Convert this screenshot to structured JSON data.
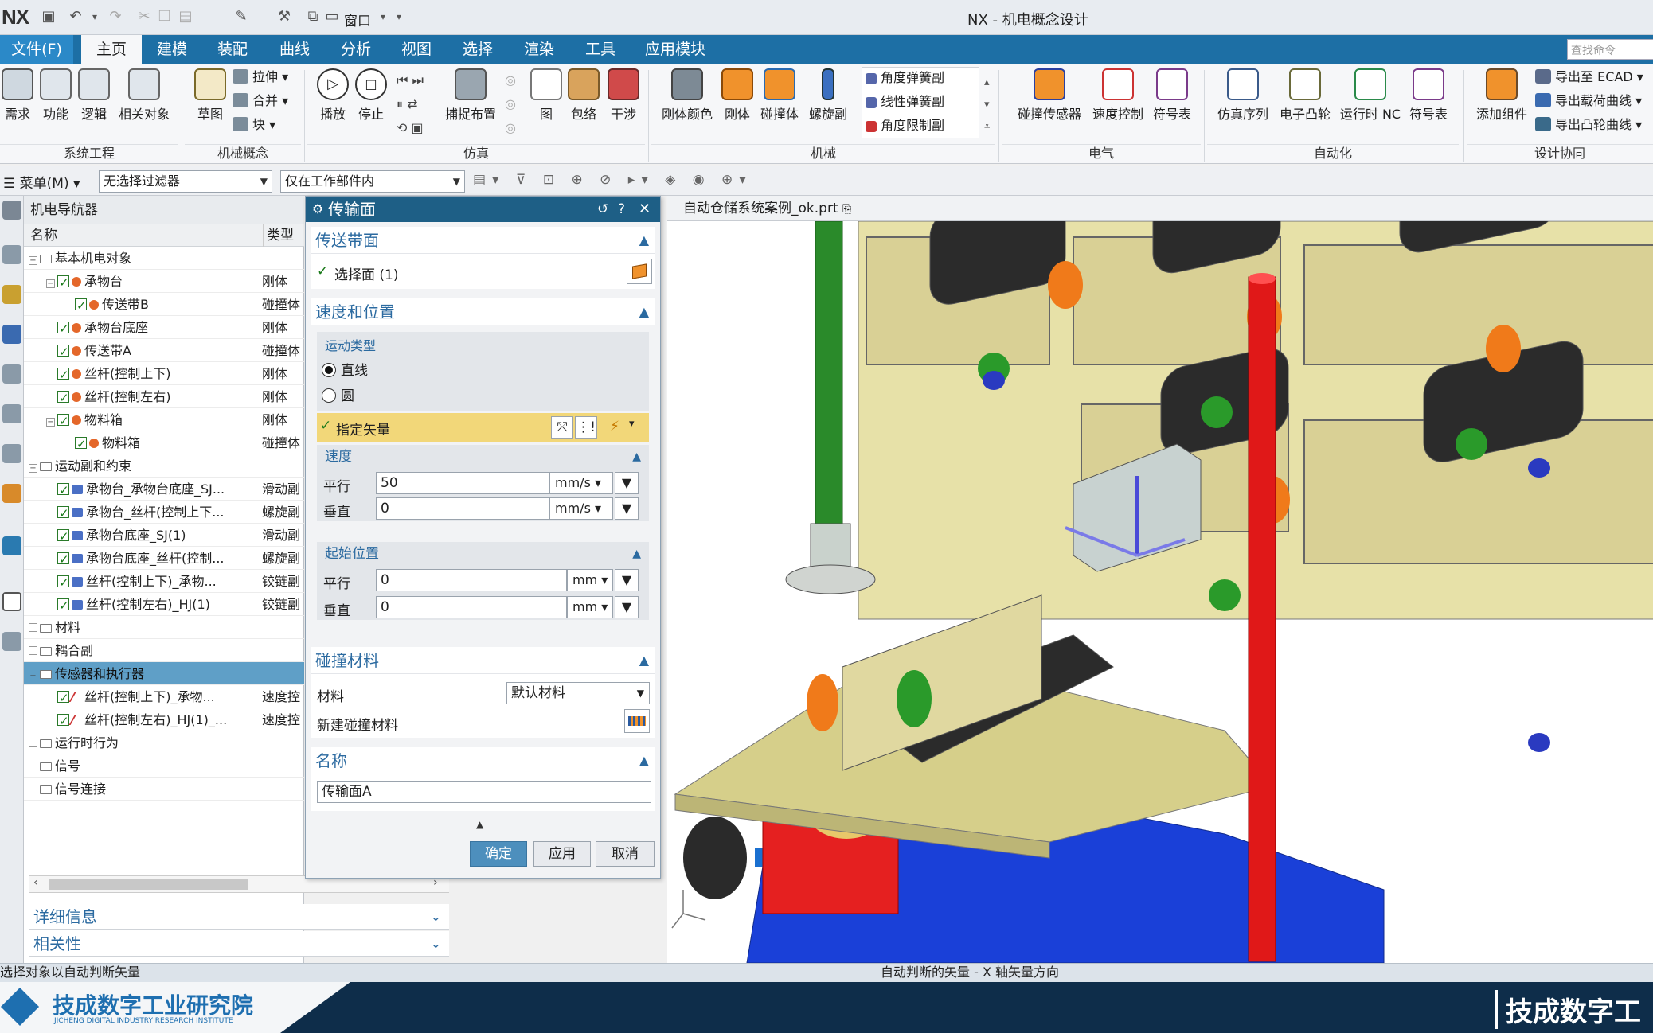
{
  "app": {
    "logo": "NX",
    "window_title": "NX - 机电概念设计",
    "window_menu": "窗口"
  },
  "tabs": [
    "文件(F)",
    "主页",
    "建模",
    "装配",
    "曲线",
    "分析",
    "视图",
    "选择",
    "渲染",
    "工具",
    "应用模块"
  ],
  "active_tab": "主页",
  "search_placeholder": "查找命令",
  "ribbon": {
    "groups": [
      "系统工程",
      "机械概念",
      "仿真",
      "机械",
      "电气",
      "自动化",
      "设计协同"
    ],
    "buttons": {
      "requirement": "需求",
      "function": "功能",
      "logic": "逻辑",
      "related_object": "相关对象",
      "sketch": "草图",
      "extrude": "拉伸",
      "unite": "合并",
      "block": "块",
      "play": "播放",
      "stop": "停止",
      "snap_layout": "捕捉布置",
      "graph": "图",
      "wrap": "包络",
      "interference": "干涉",
      "rigid_color": "刚体颜色",
      "rigid_body": "刚体",
      "collision_body": "碰撞体",
      "screw_joint": "螺旋副",
      "angular_spring": "角度弹簧副",
      "linear_spring": "线性弹簧副",
      "angular_limit": "角度限制副",
      "collision_sensor": "碰撞传感器",
      "speed_control": "速度控制",
      "symbol_table": "符号表",
      "sim_sequence": "仿真序列",
      "e_cam": "电子凸轮",
      "runtime_nc": "运行时 NC",
      "symbol_table2": "符号表",
      "add_component": "添加组件",
      "export_ecad": "导出至 ECAD",
      "export_load_curve": "导出载荷曲线",
      "export_cam_curve": "导出凸轮曲线"
    }
  },
  "selection_bar": {
    "menu": "菜单(M)",
    "filter": "无选择过滤器",
    "scope": "仅在工作部件内"
  },
  "navigator": {
    "title": "机电导航器",
    "col_name": "名称",
    "col_type": "类型",
    "rows": [
      {
        "label": "基本机电对象",
        "type": "",
        "level": 0,
        "kind": "folder"
      },
      {
        "label": "承物台",
        "type": "刚体",
        "level": 1,
        "kind": "body"
      },
      {
        "label": "传送带B",
        "type": "碰撞体",
        "level": 2,
        "kind": "body"
      },
      {
        "label": "承物台底座",
        "type": "刚体",
        "level": 1,
        "kind": "body"
      },
      {
        "label": "传送带A",
        "type": "碰撞体",
        "level": 1,
        "kind": "body"
      },
      {
        "label": "丝杆(控制上下)",
        "type": "刚体",
        "level": 1,
        "kind": "body"
      },
      {
        "label": "丝杆(控制左右)",
        "type": "刚体",
        "level": 1,
        "kind": "body"
      },
      {
        "label": "物料箱",
        "type": "刚体",
        "level": 1,
        "kind": "body"
      },
      {
        "label": "物料箱",
        "type": "碰撞体",
        "level": 2,
        "kind": "body"
      },
      {
        "label": "运动副和约束",
        "type": "",
        "level": 0,
        "kind": "folder"
      },
      {
        "label": "承物台_承物台底座_SJ...",
        "type": "滑动副",
        "level": 1,
        "kind": "joint"
      },
      {
        "label": "承物台_丝杆(控制上下...",
        "type": "螺旋副",
        "level": 1,
        "kind": "joint"
      },
      {
        "label": "承物台底座_SJ(1)",
        "type": "滑动副",
        "level": 1,
        "kind": "joint"
      },
      {
        "label": "承物台底座_丝杆(控制...",
        "type": "螺旋副",
        "level": 1,
        "kind": "joint"
      },
      {
        "label": "丝杆(控制上下)_承物...",
        "type": "铰链副",
        "level": 1,
        "kind": "joint"
      },
      {
        "label": "丝杆(控制左右)_HJ(1)",
        "type": "铰链副",
        "level": 1,
        "kind": "joint"
      },
      {
        "label": "材料",
        "type": "",
        "level": 0,
        "kind": "folder"
      },
      {
        "label": "耦合副",
        "type": "",
        "level": 0,
        "kind": "folder"
      },
      {
        "label": "传感器和执行器",
        "type": "",
        "level": 0,
        "kind": "folder",
        "selected": true
      },
      {
        "label": "丝杆(控制上下)_承物...",
        "type": "速度控",
        "level": 1,
        "kind": "sensor"
      },
      {
        "label": "丝杆(控制左右)_HJ(1)_...",
        "type": "速度控",
        "level": 1,
        "kind": "sensor"
      },
      {
        "label": "运行时行为",
        "type": "",
        "level": 0,
        "kind": "folder"
      },
      {
        "label": "信号",
        "type": "",
        "level": 0,
        "kind": "folder"
      },
      {
        "label": "信号连接",
        "type": "",
        "level": 0,
        "kind": "folder"
      }
    ],
    "details_label": "详细信息",
    "dependencies_label": "相关性"
  },
  "dialog": {
    "title": "传输面",
    "sec_face": "传送带面",
    "select_face": "选择面 (1)",
    "sec_speed_pos": "速度和位置",
    "motion_type": "运动类型",
    "opt_linear": "直线",
    "opt_circle": "圆",
    "motion_selected": "直线",
    "vector_label": "指定矢量",
    "sub_speed": "速度",
    "parallel": "平行",
    "perpendicular": "垂直",
    "speed_parallel": "50",
    "speed_perp": "0",
    "speed_unit": "mm/s",
    "sub_start": "起始位置",
    "start_parallel": "0",
    "start_perp": "0",
    "pos_unit": "mm",
    "sec_collision": "碰撞材料",
    "material_label": "材料",
    "material_value": "默认材料",
    "new_material": "新建碰撞材料",
    "sec_name": "名称",
    "name_value": "传输面A",
    "ok": "确定",
    "apply": "应用",
    "cancel": "取消"
  },
  "viewport": {
    "file_tab": "自动仓储系统案例_ok.prt"
  },
  "status": {
    "left": "选择对象以自动判断矢量",
    "center": "自动判断的矢量 - X 轴矢量方向"
  },
  "footer": {
    "brand": "技成数字工业研究院",
    "brand_en": "JICHENG DIGITAL INDUSTRY RESEARCH INSTITUTE",
    "brand_right": "技成数字工"
  },
  "colors": {
    "tab_bar": "#1d6fa5",
    "dialog_title": "#1e5f86",
    "section_text": "#2b6aa0",
    "highlight_row": "#f2d779",
    "selected_tree": "#5f9fc7"
  }
}
